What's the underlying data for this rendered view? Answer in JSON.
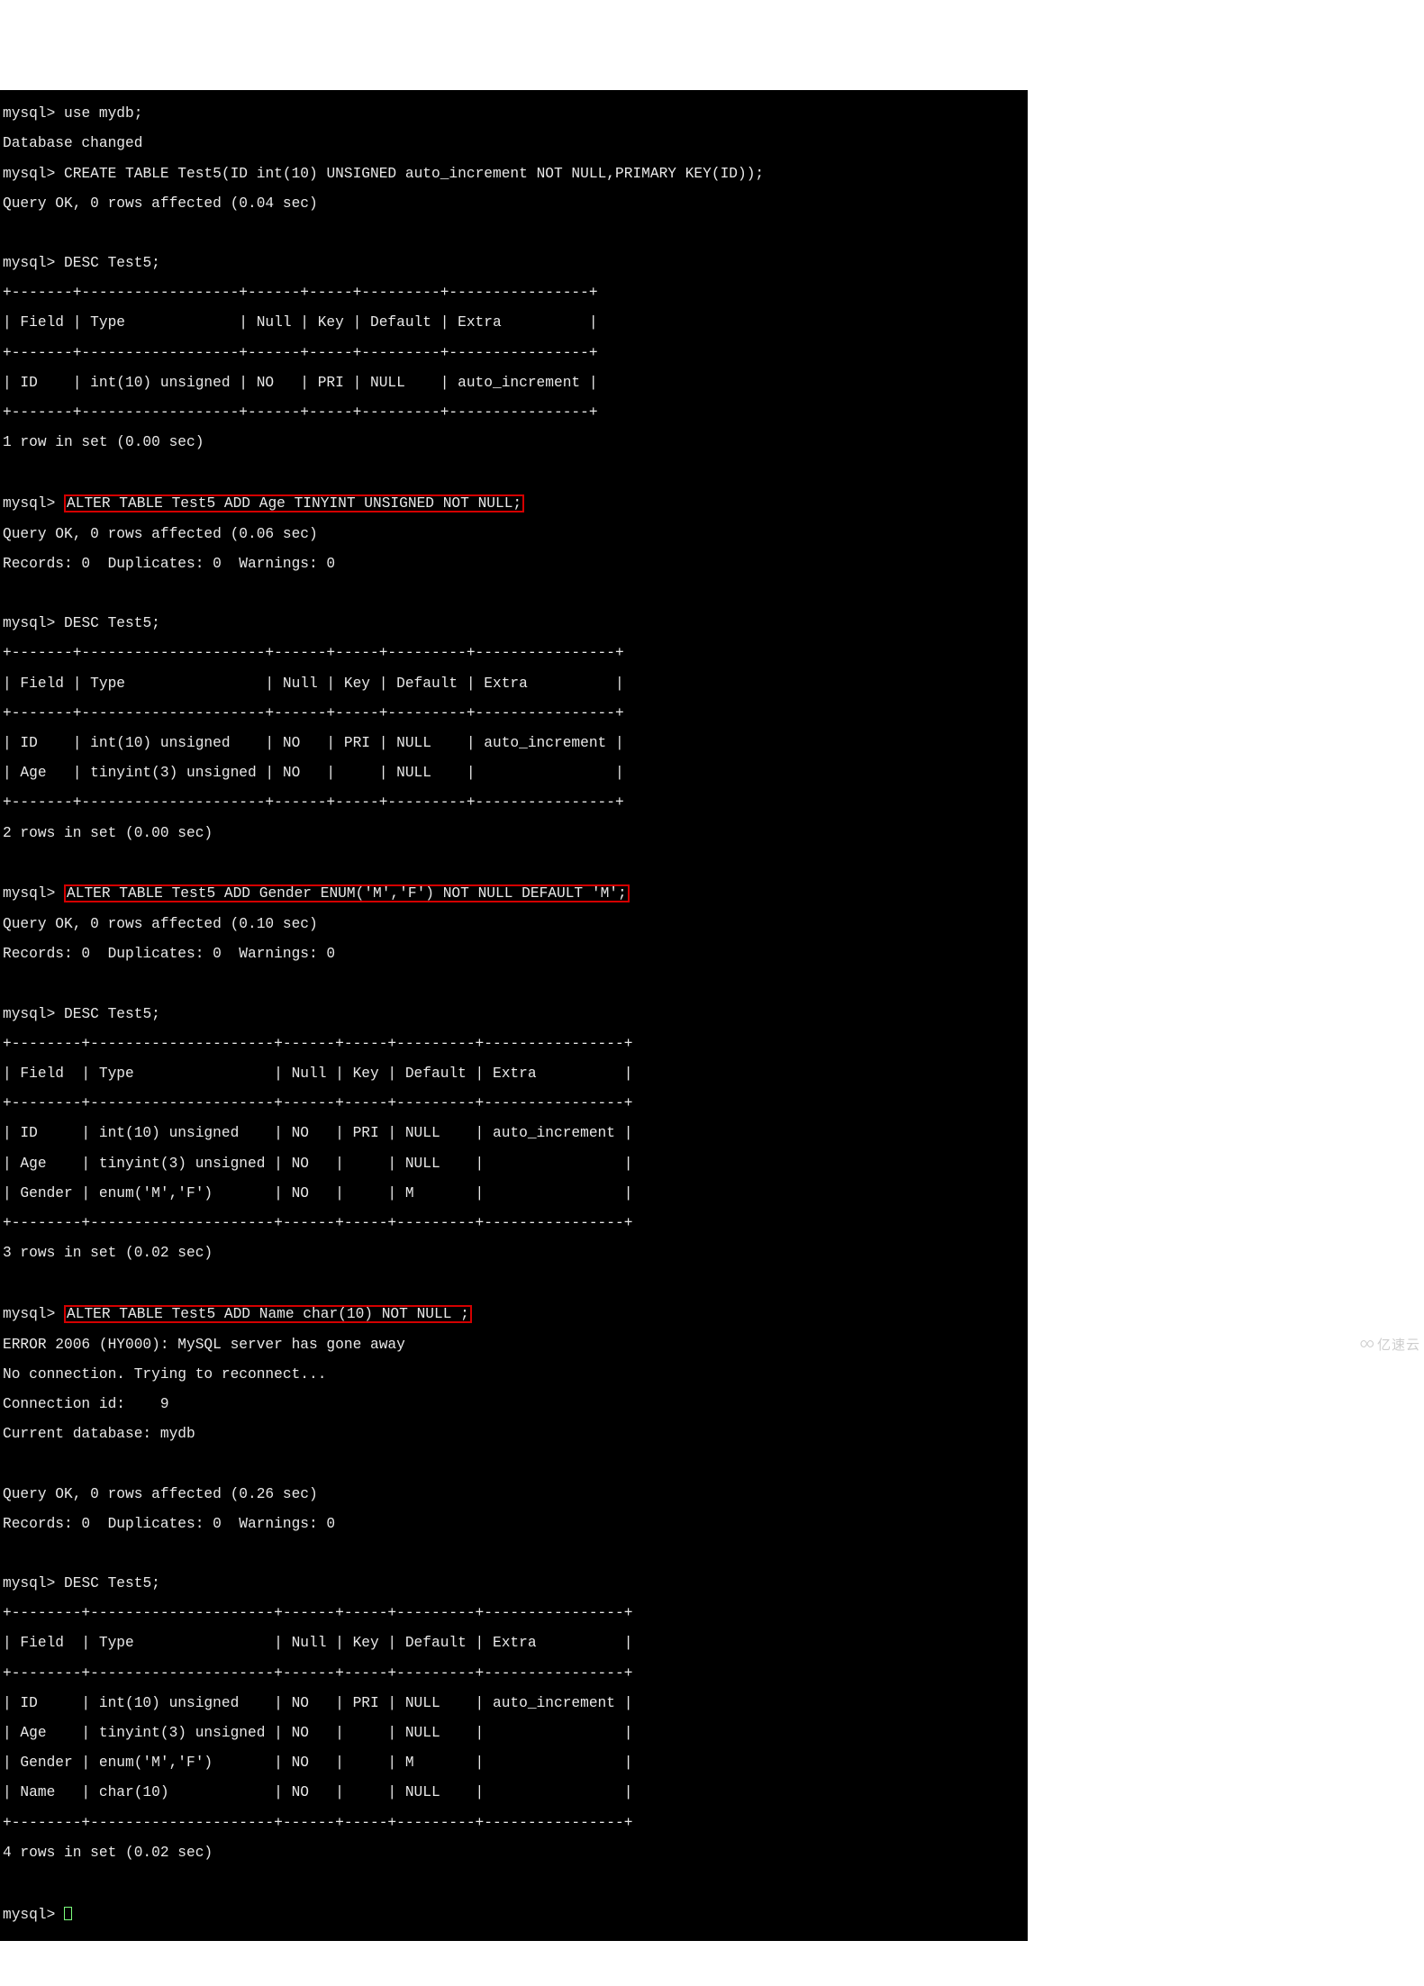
{
  "prompt": "mysql>",
  "cmds": {
    "use": "use mydb;",
    "create": "CREATE TABLE Test5(ID int(10) UNSIGNED auto_increment NOT NULL,PRIMARY KEY(ID));",
    "desc": "DESC Test5;",
    "alter1": "ALTER TABLE Test5 ADD Age TINYINT UNSIGNED NOT NULL;",
    "alter2": "ALTER TABLE Test5 ADD Gender ENUM('M','F') NOT NULL DEFAULT 'M';",
    "alter3": "ALTER TABLE Test5 ADD Name char(10) NOT NULL ;"
  },
  "msg": {
    "db_changed": "Database changed",
    "ok004": "Query OK, 0 rows affected (0.04 sec)",
    "ok006": "Query OK, 0 rows affected (0.06 sec)",
    "ok010": "Query OK, 0 rows affected (0.10 sec)",
    "ok026": "Query OK, 0 rows affected (0.26 sec)",
    "records0": "Records: 0  Duplicates: 0  Warnings: 0",
    "rows1_000": "1 row in set (0.00 sec)",
    "rows2_000": "2 rows in set (0.00 sec)",
    "rows3_002": "3 rows in set (0.02 sec)",
    "rows4_002": "4 rows in set (0.02 sec)",
    "err2006": "ERROR 2006 (HY000): MySQL server has gone away",
    "noconn": "No connection. Trying to reconnect...",
    "connid": "Connection id:    9",
    "curdb": "Current database: mydb"
  },
  "tbl1": {
    "sep": "+-------+------------------+------+-----+---------+----------------+",
    "hdr": "| Field | Type             | Null | Key | Default | Extra          |",
    "r1": "| ID    | int(10) unsigned | NO   | PRI | NULL    | auto_increment |"
  },
  "tbl2": {
    "sep": "+-------+---------------------+------+-----+---------+----------------+",
    "hdr": "| Field | Type                | Null | Key | Default | Extra          |",
    "r1": "| ID    | int(10) unsigned    | NO   | PRI | NULL    | auto_increment |",
    "r2": "| Age   | tinyint(3) unsigned | NO   |     | NULL    |                |"
  },
  "tbl3": {
    "sep": "+--------+---------------------+------+-----+---------+----------------+",
    "hdr": "| Field  | Type                | Null | Key | Default | Extra          |",
    "r1": "| ID     | int(10) unsigned    | NO   | PRI | NULL    | auto_increment |",
    "r2": "| Age    | tinyint(3) unsigned | NO   |     | NULL    |                |",
    "r3": "| Gender | enum('M','F')       | NO   |     | M       |                |"
  },
  "tbl4": {
    "sep": "+--------+---------------------+------+-----+---------+----------------+",
    "hdr": "| Field  | Type                | Null | Key | Default | Extra          |",
    "r1": "| ID     | int(10) unsigned    | NO   | PRI | NULL    | auto_increment |",
    "r2": "| Age    | tinyint(3) unsigned | NO   |     | NULL    |                |",
    "r3": "| Gender | enum('M','F')       | NO   |     | M       |                |",
    "r4": "| Name   | char(10)            | NO   |     | NULL    |                |"
  },
  "watermark": "亿速云"
}
